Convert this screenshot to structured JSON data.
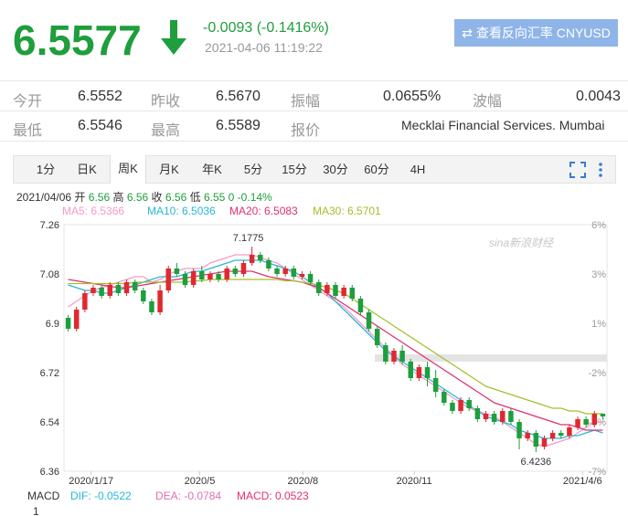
{
  "quote": {
    "price": "6.5577",
    "change": "-0.0093 (-0.1416%)",
    "timestamp": "2021-04-06 11:19:22",
    "button_label": "查看反向汇率 CNYUSD"
  },
  "stats": {
    "row1": [
      {
        "label": "今开",
        "value": "6.5552"
      },
      {
        "label": "昨收",
        "value": "6.5670"
      },
      {
        "label": "振幅",
        "value": "0.0655%"
      },
      {
        "label": "波幅",
        "value": "0.0043"
      }
    ],
    "row2": [
      {
        "label": "最低",
        "value": "6.5546"
      },
      {
        "label": "最高",
        "value": "6.5589"
      },
      {
        "label": "报价",
        "value": "Mecklai Financial Services. Mumbai"
      }
    ]
  },
  "tabs": [
    "1分",
    "日K",
    "周K",
    "月K",
    "年K",
    "5分",
    "15分",
    "30分",
    "60分",
    "4H"
  ],
  "active_tab": "周K",
  "info": {
    "date": "2021/04/06",
    "open_label": "开",
    "open": "6.56",
    "high_label": "高",
    "high": "6.56",
    "close_label": "收",
    "close": "6.56",
    "low_label": "低",
    "low": "6.55",
    "vol": "0",
    "pct": "-0.14%"
  },
  "ma_legend": [
    {
      "text": "MA5: 6.5366",
      "color": "#f59ac6"
    },
    {
      "text": "MA10: 6.5036",
      "color": "#27b7d9"
    },
    {
      "text": "MA20: 6.5083",
      "color": "#e0306e"
    },
    {
      "text": "MA30: 6.5701",
      "color": "#a2c02c"
    }
  ],
  "macd": {
    "label": "MACD",
    "dif": "DIF: -0.0522",
    "dea": "DEA: -0.0784",
    "macd": "MACD: 0.0523",
    "axis_value": "1"
  },
  "watermark": "sina新浪财经",
  "chart_data": {
    "type": "candlestick",
    "y_ticks": [
      "7.26",
      "7.08",
      "6.9",
      "6.72",
      "6.54",
      "6.36"
    ],
    "y_range": [
      6.36,
      7.26
    ],
    "pct_ticks": [
      "6%",
      "3%",
      "1%",
      "-2%",
      "-5%",
      "-7%"
    ],
    "x_labels": [
      "2020/1/17",
      "2020/5",
      "2020/8",
      "2020/11",
      "2021/4/6"
    ],
    "annotations": {
      "max": "7.1775",
      "min": "6.4236"
    },
    "series": [
      {
        "name": "MA5",
        "color": "#f59ac6",
        "values": [
          6.96,
          6.98,
          7.0,
          7.02,
          7.03,
          7.04,
          7.05,
          7.06,
          7.07,
          7.07,
          7.05,
          7.06,
          7.08,
          7.09,
          7.1,
          7.1,
          7.1,
          7.12,
          7.13,
          7.14,
          7.15,
          7.15,
          7.15,
          7.14,
          7.13,
          7.12,
          7.1,
          7.08,
          7.06,
          7.04,
          7.02,
          7.0,
          6.98,
          6.96,
          6.93,
          6.9,
          6.87,
          6.84,
          6.81,
          6.78,
          6.75,
          6.73,
          6.71,
          6.69,
          6.67,
          6.65,
          6.63,
          6.61,
          6.59,
          6.58,
          6.57,
          6.56,
          6.54,
          6.52,
          6.5,
          6.48,
          6.46,
          6.45,
          6.46,
          6.47,
          6.48,
          6.5,
          6.52,
          6.54,
          6.54
        ]
      },
      {
        "name": "MA10",
        "color": "#27b7d9",
        "values": [
          7.04,
          7.03,
          7.02,
          7.02,
          7.01,
          7.01,
          7.02,
          7.03,
          7.04,
          7.05,
          7.06,
          7.07,
          7.07,
          7.07,
          7.08,
          7.09,
          7.09,
          7.1,
          7.11,
          7.12,
          7.13,
          7.13,
          7.13,
          7.13,
          7.12,
          7.11,
          7.1,
          7.09,
          7.07,
          7.05,
          7.03,
          7.01,
          6.98,
          6.95,
          6.92,
          6.89,
          6.86,
          6.83,
          6.8,
          6.78,
          6.76,
          6.74,
          6.72,
          6.7,
          6.68,
          6.66,
          6.64,
          6.62,
          6.6,
          6.58,
          6.56,
          6.55,
          6.54,
          6.53,
          6.51,
          6.5,
          6.49,
          6.48,
          6.48,
          6.48,
          6.49,
          6.49,
          6.5,
          6.51,
          6.5
        ]
      },
      {
        "name": "MA20",
        "color": "#e0306e",
        "values": [
          7.06,
          7.055,
          7.05,
          7.045,
          7.04,
          7.035,
          7.03,
          7.03,
          7.035,
          7.04,
          7.045,
          7.05,
          7.055,
          7.06,
          7.065,
          7.07,
          7.075,
          7.08,
          7.085,
          7.09,
          7.09,
          7.09,
          7.09,
          7.08,
          7.07,
          7.065,
          7.06,
          7.055,
          7.05,
          7.04,
          7.03,
          7.01,
          6.99,
          6.97,
          6.95,
          6.93,
          6.91,
          6.89,
          6.87,
          6.85,
          6.83,
          6.81,
          6.79,
          6.77,
          6.75,
          6.73,
          6.71,
          6.69,
          6.67,
          6.65,
          6.63,
          6.61,
          6.6,
          6.59,
          6.58,
          6.57,
          6.56,
          6.55,
          6.54,
          6.53,
          6.53,
          6.52,
          6.51,
          6.51,
          6.51
        ]
      },
      {
        "name": "MA30",
        "color": "#a2c02c",
        "values": [
          7.045,
          7.045,
          7.045,
          7.045,
          7.045,
          7.045,
          7.045,
          7.045,
          7.05,
          7.05,
          7.05,
          7.05,
          7.05,
          7.05,
          7.05,
          7.055,
          7.055,
          7.06,
          7.06,
          7.06,
          7.06,
          7.06,
          7.06,
          7.06,
          7.06,
          7.06,
          7.055,
          7.055,
          7.05,
          7.045,
          7.04,
          7.03,
          7.02,
          7.01,
          6.99,
          6.97,
          6.95,
          6.93,
          6.91,
          6.89,
          6.87,
          6.85,
          6.83,
          6.81,
          6.79,
          6.77,
          6.75,
          6.73,
          6.71,
          6.69,
          6.67,
          6.66,
          6.65,
          6.64,
          6.63,
          6.62,
          6.61,
          6.6,
          6.59,
          6.59,
          6.58,
          6.58,
          6.57,
          6.57,
          6.57
        ]
      }
    ],
    "candles": [
      [
        6.92,
        6.88,
        6.93,
        6.87
      ],
      [
        6.88,
        6.95,
        6.96,
        6.87
      ],
      [
        6.95,
        7.01,
        7.02,
        6.94
      ],
      [
        7.01,
        7.03,
        7.04,
        7.0
      ],
      [
        7.03,
        7.0,
        7.04,
        6.99
      ],
      [
        7.0,
        7.04,
        7.05,
        6.99
      ],
      [
        7.04,
        7.01,
        7.05,
        7.0
      ],
      [
        7.01,
        7.05,
        7.06,
        7.0
      ],
      [
        7.05,
        7.02,
        7.06,
        7.01
      ],
      [
        7.02,
        6.98,
        7.03,
        6.97
      ],
      [
        6.98,
        6.94,
        6.99,
        6.93
      ],
      [
        6.94,
        7.02,
        7.04,
        6.93
      ],
      [
        7.02,
        7.1,
        7.11,
        7.01
      ],
      [
        7.1,
        7.08,
        7.12,
        7.07
      ],
      [
        7.08,
        7.04,
        7.09,
        7.03
      ],
      [
        7.04,
        7.09,
        7.1,
        7.03
      ],
      [
        7.09,
        7.06,
        7.11,
        7.05
      ],
      [
        7.06,
        7.08,
        7.09,
        7.05
      ],
      [
        7.08,
        7.06,
        7.09,
        7.05
      ],
      [
        7.06,
        7.1,
        7.11,
        7.05
      ],
      [
        7.1,
        7.08,
        7.11,
        7.07
      ],
      [
        7.08,
        7.12,
        7.13,
        7.07
      ],
      [
        7.12,
        7.15,
        7.18,
        7.11
      ],
      [
        7.15,
        7.13,
        7.16,
        7.12
      ],
      [
        7.13,
        7.1,
        7.14,
        7.09
      ],
      [
        7.1,
        7.08,
        7.11,
        7.07
      ],
      [
        7.08,
        7.1,
        7.11,
        7.07
      ],
      [
        7.1,
        7.07,
        7.11,
        7.06
      ],
      [
        7.07,
        7.08,
        7.09,
        7.06
      ],
      [
        7.08,
        7.05,
        7.09,
        7.04
      ],
      [
        7.05,
        7.01,
        7.06,
        7.0
      ],
      [
        7.01,
        7.04,
        7.05,
        7.0
      ],
      [
        7.04,
        7.0,
        7.05,
        6.99
      ],
      [
        7.0,
        7.03,
        7.04,
        6.99
      ],
      [
        7.03,
        6.99,
        7.04,
        6.98
      ],
      [
        6.99,
        6.94,
        7.0,
        6.93
      ],
      [
        6.94,
        6.88,
        6.95,
        6.87
      ],
      [
        6.88,
        6.82,
        6.89,
        6.81
      ],
      [
        6.82,
        6.76,
        6.83,
        6.75
      ],
      [
        6.76,
        6.8,
        6.81,
        6.75
      ],
      [
        6.8,
        6.76,
        6.82,
        6.75
      ],
      [
        6.76,
        6.7,
        6.77,
        6.69
      ],
      [
        6.7,
        6.74,
        6.75,
        6.69
      ],
      [
        6.74,
        6.7,
        6.76,
        6.67
      ],
      [
        6.7,
        6.65,
        6.73,
        6.63
      ],
      [
        6.65,
        6.61,
        6.66,
        6.6
      ],
      [
        6.61,
        6.58,
        6.62,
        6.57
      ],
      [
        6.58,
        6.62,
        6.63,
        6.57
      ],
      [
        6.62,
        6.59,
        6.63,
        6.58
      ],
      [
        6.59,
        6.55,
        6.6,
        6.54
      ],
      [
        6.55,
        6.57,
        6.58,
        6.54
      ],
      [
        6.57,
        6.54,
        6.58,
        6.53
      ],
      [
        6.54,
        6.58,
        6.59,
        6.53
      ],
      [
        6.58,
        6.54,
        6.59,
        6.53
      ],
      [
        6.54,
        6.48,
        6.55,
        6.44
      ],
      [
        6.48,
        6.5,
        6.51,
        6.47
      ],
      [
        6.5,
        6.45,
        6.51,
        6.43
      ],
      [
        6.45,
        6.48,
        6.49,
        6.44
      ],
      [
        6.48,
        6.5,
        6.51,
        6.47
      ],
      [
        6.5,
        6.49,
        6.51,
        6.48
      ],
      [
        6.49,
        6.52,
        6.53,
        6.48
      ],
      [
        6.52,
        6.55,
        6.56,
        6.51
      ],
      [
        6.55,
        6.53,
        6.56,
        6.52
      ],
      [
        6.53,
        6.57,
        6.58,
        6.52
      ],
      [
        6.57,
        6.56,
        6.57,
        6.55
      ]
    ]
  }
}
